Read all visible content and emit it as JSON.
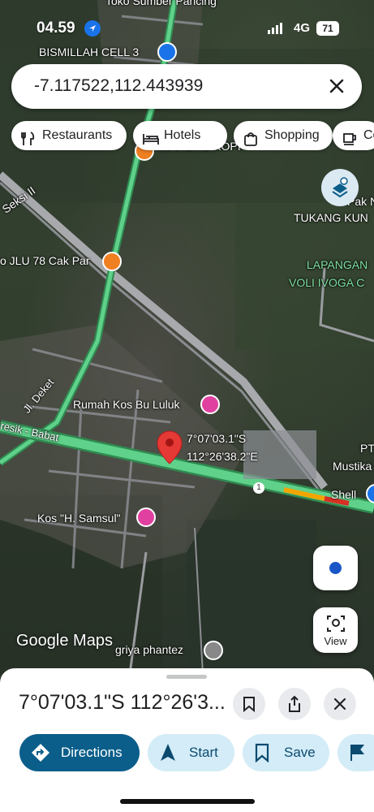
{
  "status_bar": {
    "time": "04.59",
    "network": "4G",
    "battery": "71"
  },
  "search": {
    "query": "-7.117522,112.443939"
  },
  "chips": [
    {
      "label": "Restaurants",
      "icon": "fork-knife-icon"
    },
    {
      "label": "Hotels",
      "icon": "bed-icon"
    },
    {
      "label": "Shopping",
      "icon": "shopping-bag-icon"
    },
    {
      "label": "Co",
      "icon": "coffee-icon"
    }
  ],
  "map": {
    "labels": {
      "top_road": "Toko Sumber Pancing",
      "bismillah": "BISMILLAH CELL 3",
      "warung": "WARUNG KOPI",
      "seksi": "Seksi II",
      "pak_n": "Pak N",
      "tukang": "TUKANG KUN",
      "lapangan_1": "LAPANGAN",
      "lapangan_2": "VOLI IVOGA C",
      "jlu": "o JLU 78 Cak Par",
      "jl_deket": "Jl. Deket",
      "rumah_kos": "Rumah Kos Bu Luluk",
      "gresik": "resik - Babat",
      "pin_lat": "7°07'03.1\"S",
      "pin_lng": "112°26'38.2\"E",
      "pt": "PT",
      "mustika": "Mustika",
      "shell": "Shell",
      "kos_samsul": "Kos \"H. Samsul\"",
      "griya": "griya phantez",
      "route_shield": "1"
    },
    "logo": "Google Maps",
    "view_label": "View",
    "colors": {
      "highway": "#5fd18a",
      "pin": "#e53935",
      "accent": "#1a73e8"
    }
  },
  "sheet": {
    "title": "7°07'03.1\"S 112°26'3...",
    "actions": [
      {
        "label": "Directions",
        "icon": "directions-icon"
      },
      {
        "label": "Start",
        "icon": "navigation-arrow-icon"
      },
      {
        "label": "Save",
        "icon": "bookmark-icon"
      },
      {
        "label": "",
        "icon": "flag-icon"
      }
    ]
  }
}
